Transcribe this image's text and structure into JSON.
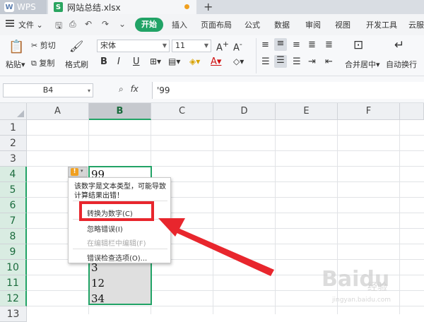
{
  "tabs": {
    "app": "WPS",
    "file": "网站总结.xlsx"
  },
  "menu": {
    "file": "文件",
    "items": [
      "开始",
      "插入",
      "页面布局",
      "公式",
      "数据",
      "审阅",
      "视图",
      "开发工具",
      "云服"
    ]
  },
  "ribbon": {
    "paste": "粘贴",
    "cut": "剪切",
    "copy": "复制",
    "format_painter": "格式刷",
    "font": "宋体",
    "size": "11",
    "merge": "合并居中",
    "wrap": "自动换行"
  },
  "formula": {
    "cell_ref": "B4",
    "fx": "fx",
    "content": "'99"
  },
  "grid": {
    "columns": [
      "A",
      "B",
      "C",
      "D",
      "E",
      "F"
    ],
    "rows": [
      "1",
      "2",
      "3",
      "4",
      "5",
      "6",
      "7",
      "8",
      "9",
      "10",
      "11",
      "12",
      "13"
    ],
    "cells": {
      "b4": "99",
      "b10": "3",
      "b11": "12",
      "b12": "34"
    }
  },
  "popup": {
    "message": "该数字是文本类型，可能导致计算结果出错！",
    "convert": "转换为数字(C)",
    "ignore": "忽略错误(I)",
    "edit_in_bar": "在编辑栏中编辑(F)",
    "options": "错误检查选项(O)..."
  },
  "watermark": {
    "brand": "Baidu",
    "sub": "经验",
    "url": "jingyan.baidu.com"
  }
}
